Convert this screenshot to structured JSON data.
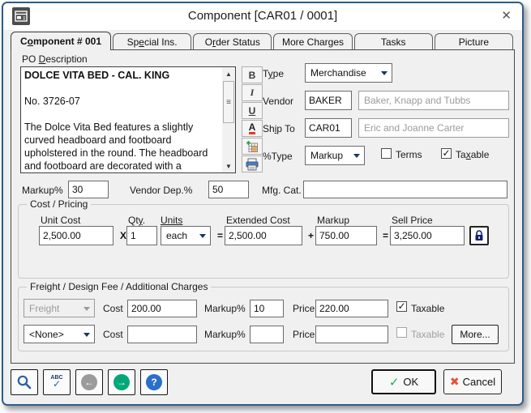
{
  "window": {
    "title": "Component [CAR01 / 0001]"
  },
  "icons": {
    "close": "✕",
    "scroll_up": "▲",
    "scroll_down": "▼",
    "scroll_grip": "≡",
    "check": "✓",
    "prev": "←",
    "next": "→",
    "help": "?",
    "spellcheck_text": "ABC",
    "spellcheck_mark": "✓",
    "ok_check": "✓",
    "cancel_x": "✖"
  },
  "tabs": [
    {
      "pre": "C",
      "u": "o",
      "post": "mponent # 001",
      "active": true
    },
    {
      "pre": "Sp",
      "u": "e",
      "post": "cial Ins.",
      "active": false
    },
    {
      "pre": "O",
      "u": "r",
      "post": "der Status",
      "active": false
    },
    {
      "pre": "More Charges",
      "u": "",
      "post": "",
      "active": false
    },
    {
      "pre": "Tasks",
      "u": "",
      "post": "",
      "active": false
    },
    {
      "pre": "Picture",
      "u": "",
      "post": "",
      "active": false
    }
  ],
  "po_description": {
    "label": {
      "pre": "PO ",
      "u": "D",
      "post": "escription"
    },
    "title_line": "DOLCE VITA BED - CAL. KING",
    "item_no": "No. 3726-07",
    "body": "The Dolce Vita Bed features a slightly curved headboard and footboard upholstered in the round. The headboard and footboard are decorated with a"
  },
  "format_toolbar": {
    "bold": "B",
    "italic": "I",
    "underline": "U",
    "font_color": "A"
  },
  "fields": {
    "type": {
      "label": {
        "pre": "T",
        "u": "y",
        "post": "pe"
      },
      "value": "Merchandise"
    },
    "vendor": {
      "label": "Vendor",
      "code": "BAKER",
      "name": "Baker, Knapp and Tubbs"
    },
    "ship_to": {
      "label": {
        "pre": "Sh",
        "u": "i",
        "post": "p To"
      },
      "code": "CAR01",
      "name": "Eric and Joanne Carter"
    },
    "pct_type": {
      "label": "%Type",
      "value": "Markup"
    },
    "terms": {
      "label": "Terms",
      "checked": false
    },
    "taxable": {
      "label": {
        "pre": "Ta",
        "u": "x",
        "post": "able"
      },
      "checked": true
    },
    "markup_pct": {
      "label": "Markup%",
      "value": "30"
    },
    "vendor_dep_pct": {
      "label": "Vendor Dep.%",
      "value": "50"
    },
    "mfg_cat": {
      "label": "Mfg. Cat.",
      "value": ""
    }
  },
  "cost_pricing": {
    "legend": "Cost / Pricing",
    "unit_cost": {
      "label": "Unit Cost",
      "value": "2,500.00"
    },
    "times": "X",
    "qty": {
      "label": {
        "pre": "Qt",
        "u": "y",
        "post": "."
      },
      "value": "1"
    },
    "units": {
      "label": {
        "pre": "",
        "u": "Units",
        "post": ""
      },
      "value": "each"
    },
    "equals1": "=",
    "extended_cost": {
      "label": "Extended Cost",
      "value": "2,500.00"
    },
    "plus": "+",
    "markup": {
      "label": "Markup",
      "value": "750.00"
    },
    "equals2": "=",
    "sell_price": {
      "label": "Sell Price",
      "value": "3,250.00"
    }
  },
  "freight": {
    "legend": "Freight / Design Fee / Additional Charges",
    "cost_label": "Cost",
    "markup_label": "Markup%",
    "price_label": "Price",
    "taxable_label": "Taxable",
    "more_label": "More...",
    "rows": [
      {
        "type_value": "Freight",
        "type_disabled": true,
        "cost": "200.00",
        "markup": "10",
        "price": "220.00",
        "taxable_checked": true,
        "taxable_disabled": false
      },
      {
        "type_value": "<None>",
        "type_disabled": false,
        "cost": "",
        "markup": "",
        "price": "",
        "taxable_checked": false,
        "taxable_disabled": true
      }
    ]
  },
  "footer": {
    "ok_label": "OK",
    "cancel_label": "Cancel"
  }
}
